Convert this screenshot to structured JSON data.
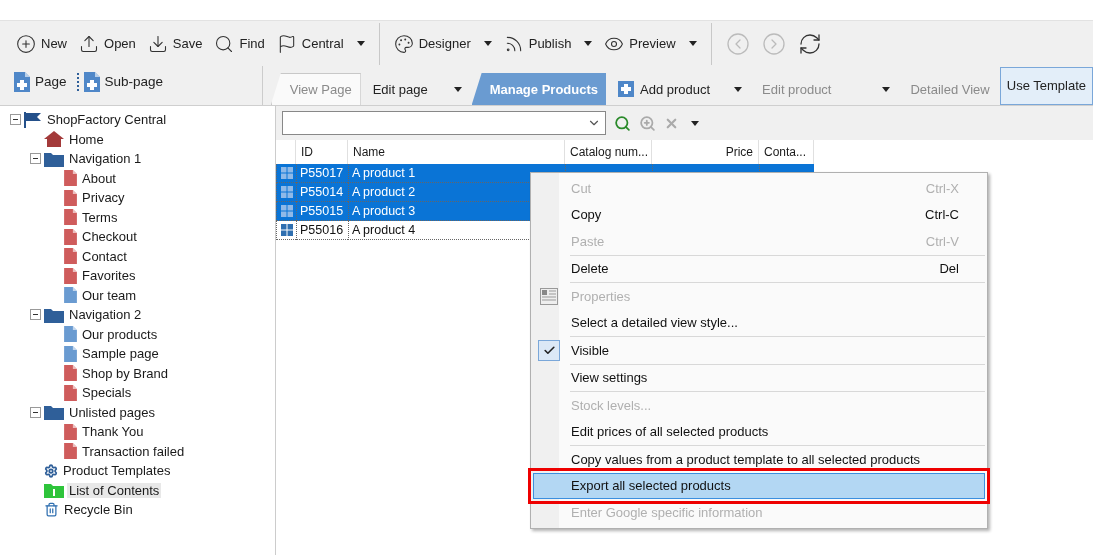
{
  "toolbar": [
    {
      "label": "New",
      "kind": "new",
      "dropdown": false,
      "disabled": false
    },
    {
      "label": "Open",
      "kind": "open",
      "dropdown": false,
      "disabled": false
    },
    {
      "label": "Save",
      "kind": "save",
      "dropdown": false,
      "disabled": false
    },
    {
      "label": "Find",
      "kind": "find",
      "dropdown": false,
      "disabled": false
    },
    {
      "label": "Central",
      "kind": "central",
      "dropdown": true,
      "disabled": false,
      "separator_after": true
    },
    {
      "label": "Designer",
      "kind": "designer",
      "dropdown": true,
      "disabled": false
    },
    {
      "label": "Publish",
      "kind": "publish",
      "dropdown": true,
      "disabled": false
    },
    {
      "label": "Preview",
      "kind": "preview",
      "dropdown": true,
      "disabled": false,
      "separator_after": true
    },
    {
      "kind": "back",
      "dropdown": false,
      "disabled": true
    },
    {
      "kind": "forward",
      "dropdown": false,
      "disabled": true
    },
    {
      "kind": "refresh",
      "dropdown": false,
      "disabled": false
    }
  ],
  "page_buttons": [
    {
      "label": "Page",
      "kind": "page"
    },
    {
      "label": "Sub-page",
      "kind": "subpage"
    }
  ],
  "tabs": [
    {
      "label": "View Page",
      "selected": false,
      "disabled": true,
      "dropdown": false,
      "kind": "tab"
    },
    {
      "label": "Edit page",
      "selected": false,
      "disabled": false,
      "dropdown": true,
      "kind": "plain"
    },
    {
      "label": "Manage Products",
      "selected": true,
      "disabled": false,
      "dropdown": false,
      "kind": "tab"
    },
    {
      "label": "Add product",
      "selected": false,
      "disabled": false,
      "dropdown": true,
      "kind": "add"
    },
    {
      "label": "Edit product",
      "selected": false,
      "disabled": true,
      "dropdown": true,
      "kind": "plain"
    },
    {
      "label": "Detailed View",
      "selected": false,
      "disabled": true,
      "dropdown": false,
      "kind": "plain"
    }
  ],
  "use_template_button": "Use Template",
  "tree": [
    {
      "label": "ShopFactory Central",
      "kind": "flag",
      "selected": false,
      "expanded": true,
      "children": [
        {
          "label": "Home",
          "kind": "home",
          "selected": false
        },
        {
          "label": "Navigation 1",
          "kind": "folder",
          "selected": false,
          "expanded": true,
          "children": [
            {
              "label": "About",
              "kind": "page-red",
              "selected": false
            },
            {
              "label": "Privacy",
              "kind": "page-red",
              "selected": false
            },
            {
              "label": "Terms",
              "kind": "page-red",
              "selected": false
            },
            {
              "label": "Checkout",
              "kind": "page-red",
              "selected": false
            },
            {
              "label": "Contact",
              "kind": "page-red",
              "selected": false
            },
            {
              "label": "Favorites",
              "kind": "page-red",
              "selected": false
            },
            {
              "label": "Our team",
              "kind": "page-blue",
              "selected": false
            }
          ]
        },
        {
          "label": "Navigation 2",
          "kind": "folder",
          "selected": false,
          "expanded": true,
          "children": [
            {
              "label": "Our products",
              "kind": "page-blue",
              "selected": false
            },
            {
              "label": "Sample page",
              "kind": "page-blue",
              "selected": false
            },
            {
              "label": "Shop by Brand",
              "kind": "page-red",
              "selected": false
            },
            {
              "label": "Specials",
              "kind": "page-red",
              "selected": false
            }
          ]
        },
        {
          "label": "Unlisted pages",
          "kind": "folder",
          "selected": false,
          "expanded": true,
          "children": [
            {
              "label": "Thank You",
              "kind": "page-red",
              "selected": false
            },
            {
              "label": "Transaction failed",
              "kind": "page-red",
              "selected": false
            }
          ]
        },
        {
          "label": "Product Templates",
          "kind": "gear",
          "selected": false
        },
        {
          "label": "List of Contents",
          "kind": "contents",
          "selected": true
        },
        {
          "label": "Recycle Bin",
          "kind": "bin",
          "selected": false
        }
      ]
    }
  ],
  "table": {
    "columns": [
      "ID",
      "Name",
      "Catalog num...",
      "Price",
      "Conta..."
    ],
    "rows": [
      {
        "id": "P55017",
        "name": "A product 1",
        "selected": true
      },
      {
        "id": "P55014",
        "name": "A product 2",
        "selected": true
      },
      {
        "id": "P55015",
        "name": "A product 3",
        "selected": true
      },
      {
        "id": "P55016",
        "name": "A product 4",
        "selected": false
      }
    ]
  },
  "context_menu": [
    {
      "label": "Cut",
      "shortcut": "Ctrl-X",
      "disabled": true,
      "checked": false,
      "selected": false
    },
    {
      "label": "Copy",
      "shortcut": "Ctrl-C",
      "disabled": false,
      "checked": false,
      "selected": false
    },
    {
      "label": "Paste",
      "shortcut": "Ctrl-V",
      "disabled": true,
      "checked": false,
      "selected": false,
      "separator_after": true
    },
    {
      "label": "Delete",
      "shortcut": "Del",
      "disabled": false,
      "checked": false,
      "selected": false,
      "separator_after": true
    },
    {
      "label": "Properties",
      "disabled": true,
      "checked": false,
      "selected": false,
      "kind": "properties"
    },
    {
      "label": "Select a detailed view style...",
      "disabled": false,
      "checked": false,
      "selected": false,
      "separator_after": true
    },
    {
      "label": "Visible",
      "disabled": false,
      "checked": true,
      "selected": false,
      "separator_after": true
    },
    {
      "label": "View settings",
      "disabled": false,
      "checked": false,
      "selected": false,
      "separator_after": true
    },
    {
      "label": "Stock levels...",
      "disabled": true,
      "checked": false,
      "selected": false
    },
    {
      "label": "Edit prices of all selected products",
      "disabled": false,
      "checked": false,
      "selected": false,
      "separator_after": true
    },
    {
      "label": "Copy values from a product template to all selected products",
      "disabled": false,
      "checked": false,
      "selected": false
    },
    {
      "label": "Export all selected products",
      "disabled": false,
      "checked": false,
      "selected": true,
      "callout": true
    },
    {
      "label": "Enter Google specific information",
      "disabled": true,
      "checked": false,
      "selected": false
    }
  ]
}
